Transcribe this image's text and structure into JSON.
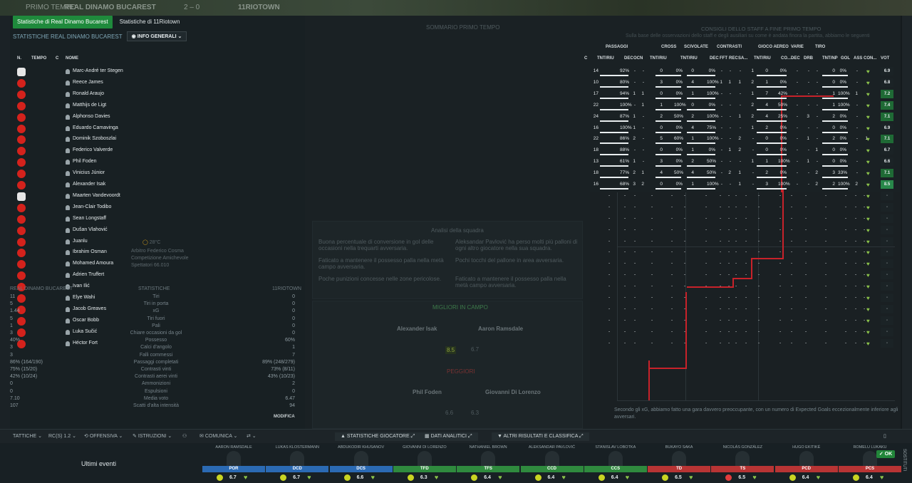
{
  "background": {
    "top_left": "PRIMO TEMPO",
    "home_team": "REAL DINAMO BUCAREST",
    "score": "2 – 0",
    "away_team": "11RIOTOWN"
  },
  "tabs": [
    {
      "label": "Statistiche di Real Dinamo Bucarest",
      "active": true
    },
    {
      "label": "Statistiche di 11Riotown",
      "active": false
    }
  ],
  "subheader": {
    "title": "STATISTICHE REAL DINAMO BUCAREST",
    "dropdown": "INFO GENERALI"
  },
  "column_groups": [
    "PASSAGGI",
    "CROSS",
    "SCIVOLATE",
    "CONTRASTI",
    "GIOCO AEREO",
    "VARIE",
    "TIRO"
  ],
  "columns": {
    "n": "N.",
    "tempo": "TEMPO",
    "c": "C",
    "nome": "NOME",
    "c2": "C",
    "pass_tnt": "TNT/RIU",
    "dec": "DEC",
    "ocn": "OCN",
    "cross_tnt": "TNT/RIU",
    "sciv_tnt": "TNT/RIU",
    "con_dec": "DEC",
    "fft": "FFT",
    "rec": "REC",
    "sa": "SA...",
    "aereo_tnt": "TNT/RIU",
    "co": "CO...",
    "varie_dec": "DEC",
    "drb": "DRB",
    "tiro": "TNT/NP",
    "gol": "GOL",
    "ass": "ASS",
    "con": "CON...",
    "vot": "VOT"
  },
  "players": [
    {
      "name": "Marc-André ter Stegen",
      "gk": true,
      "p": [
        "14",
        "92%",
        "-",
        "-"
      ],
      "cr": [
        "0",
        "0%"
      ],
      "sc": [
        "0",
        "0%"
      ],
      "ct": [
        "-",
        "-",
        "-",
        "1"
      ],
      "ae": [
        "0",
        "0%",
        "-"
      ],
      "va": [
        "-",
        "-"
      ],
      "ti": [
        "0",
        "0%"
      ],
      "g": "-",
      "a": "-",
      "v": "6.9",
      "vt": "hi"
    },
    {
      "name": "Reece James",
      "p": [
        "10",
        "80%",
        "-",
        "-"
      ],
      "cr": [
        "3",
        "0%"
      ],
      "sc": [
        "4",
        "100%"
      ],
      "ct": [
        "1",
        "1",
        "1",
        "2"
      ],
      "ae": [
        "1",
        "0%",
        "-"
      ],
      "va": [
        "-",
        "-"
      ],
      "ti": [
        "0",
        "0%"
      ],
      "g": "-",
      "a": "-",
      "v": "6.8",
      "vt": "hi"
    },
    {
      "name": "Ronald Araujo",
      "p": [
        "17",
        "94%",
        "1",
        "1"
      ],
      "cr": [
        "0",
        "0%"
      ],
      "sc": [
        "1",
        "100%"
      ],
      "ct": [
        "-",
        "-",
        "-",
        "1"
      ],
      "ae": [
        "7",
        "42%",
        "-"
      ],
      "va": [
        "-",
        "-"
      ],
      "ti": [
        "1",
        "100%"
      ],
      "g": "1",
      "a": "-",
      "v": "7.2",
      "vt": "top"
    },
    {
      "name": "Matthijs de Ligt",
      "p": [
        "22",
        "100%",
        "-",
        "1"
      ],
      "cr": [
        "1",
        "100%"
      ],
      "sc": [
        "0",
        "0%"
      ],
      "ct": [
        "-",
        "-",
        "-",
        "2"
      ],
      "ae": [
        "4",
        "50%",
        "-"
      ],
      "va": [
        "-",
        "-"
      ],
      "ti": [
        "1",
        "100%"
      ],
      "g": "-",
      "a": "-",
      "v": "7.4",
      "vt": "top"
    },
    {
      "name": "Alphonso Davies",
      "p": [
        "24",
        "87%",
        "1",
        "-"
      ],
      "cr": [
        "2",
        "50%"
      ],
      "sc": [
        "2",
        "100%"
      ],
      "ct": [
        "-",
        "-",
        "1",
        "2"
      ],
      "ae": [
        "4",
        "25%",
        "-"
      ],
      "va": [
        "3",
        "-"
      ],
      "ti": [
        "2",
        "0%"
      ],
      "g": "-",
      "a": "-",
      "v": "7.1",
      "vt": "top"
    },
    {
      "name": "Eduardo Camavinga",
      "p": [
        "16",
        "100%",
        "1",
        "-"
      ],
      "cr": [
        "0",
        "0%"
      ],
      "sc": [
        "4",
        "75%"
      ],
      "ct": [
        "-",
        "-",
        "-",
        "1"
      ],
      "ae": [
        "2",
        "0%",
        "-"
      ],
      "va": [
        "-",
        "-"
      ],
      "ti": [
        "0",
        "0%"
      ],
      "g": "-",
      "a": "-",
      "v": "6.9",
      "vt": "hi"
    },
    {
      "name": "Dominik Szoboszlai",
      "p": [
        "22",
        "86%",
        "2",
        "-"
      ],
      "cr": [
        "5",
        "60%"
      ],
      "sc": [
        "1",
        "100%"
      ],
      "ct": [
        "-",
        "-",
        "2",
        "-"
      ],
      "ae": [
        "0",
        "0%",
        "-"
      ],
      "va": [
        "1",
        "-"
      ],
      "ti": [
        "2",
        "0%"
      ],
      "g": "-",
      "a": "1",
      "v": "7.1",
      "vt": "top"
    },
    {
      "name": "Federico Valverde",
      "p": [
        "18",
        "88%",
        "-",
        "-"
      ],
      "cr": [
        "0",
        "0%"
      ],
      "sc": [
        "1",
        "0%"
      ],
      "ct": [
        "-",
        "1",
        "2",
        "-"
      ],
      "ae": [
        "0",
        "0%",
        "-"
      ],
      "va": [
        "-",
        "1"
      ],
      "ti": [
        "0",
        "0%"
      ],
      "g": "-",
      "a": "-",
      "v": "6.7",
      "vt": "hi"
    },
    {
      "name": "Phil Foden",
      "p": [
        "13",
        "61%",
        "1",
        "-"
      ],
      "cr": [
        "3",
        "0%"
      ],
      "sc": [
        "2",
        "50%"
      ],
      "ct": [
        "-",
        "-",
        "-",
        "1"
      ],
      "ae": [
        "1",
        "100%",
        "-"
      ],
      "va": [
        "1",
        "-"
      ],
      "ti": [
        "0",
        "0%"
      ],
      "g": "-",
      "a": "-",
      "v": "6.6",
      "vt": "hi"
    },
    {
      "name": "Vinicius Júnior",
      "p": [
        "18",
        "77%",
        "2",
        "1"
      ],
      "cr": [
        "4",
        "50%"
      ],
      "sc": [
        "4",
        "50%"
      ],
      "ct": [
        "-",
        "2",
        "1",
        "-"
      ],
      "ae": [
        "2",
        "0%",
        "-"
      ],
      "va": [
        "-",
        "2"
      ],
      "ti": [
        "3",
        "33%"
      ],
      "g": "-",
      "a": "-",
      "v": "7.1",
      "vt": "top"
    },
    {
      "name": "Alexander Isak",
      "p": [
        "16",
        "68%",
        "3",
        "2"
      ],
      "cr": [
        "0",
        "0%"
      ],
      "sc": [
        "1",
        "100%"
      ],
      "ct": [
        "-",
        "-",
        "1",
        "-"
      ],
      "ae": [
        "3",
        "100%",
        "-"
      ],
      "va": [
        "-",
        "2"
      ],
      "ti": [
        "2",
        "100%"
      ],
      "g": "2",
      "a": "-",
      "v": "8.5",
      "vt": "best"
    },
    {
      "name": "Maarten Vandevoordt",
      "gk": true,
      "sub": true
    },
    {
      "name": "Jean-Clair Todibo",
      "sub": true
    },
    {
      "name": "Sean Longstaff",
      "sub": true
    },
    {
      "name": "Dušan Vlahović",
      "sub": true
    },
    {
      "name": "Juanlu",
      "sub": true
    },
    {
      "name": "Ibrahim Osman",
      "sub": true
    },
    {
      "name": "Mohamed Amoura",
      "sub": true
    },
    {
      "name": "Adrien Truffert",
      "sub": true
    },
    {
      "name": "Ivan Ilić",
      "sub": true
    },
    {
      "name": "Elye Wahi",
      "sub": true
    },
    {
      "name": "Jacob Greaves",
      "sub": true
    },
    {
      "name": "Oscar Bobb",
      "sub": true
    },
    {
      "name": "Luka Sučić",
      "sub": true
    },
    {
      "name": "Héctor Fort",
      "sub": true
    }
  ],
  "center": {
    "summary_title": "SOMMARIO PRIMO TEMPO",
    "staff_title": "CONSIGLI DELLO STAFF A FINE PRIMO TEMPO",
    "staff_sub": "Sulla base delle osservazioni dello staff e degli ausiliari su come è andata finora la partita, abbiamo le seguenti",
    "analysis_title": "Analisi della squadra",
    "analysis_left": [
      "Buona percentuale di conversione in gol delle occasioni nella trequarti avversaria.",
      "Faticato a mantenere il possesso palla nella metà campo avversaria.",
      "Poche punizioni concesse nelle zone pericolose."
    ],
    "analysis_right": [
      "Aleksandar Pavlović ha perso molti più palloni di ogni altro giocatore nella sua squadra.",
      "Pochi tocchi del pallone in area avversaria.",
      "Faticato a mantenere il possesso palla nella metà campo avversaria."
    ],
    "best_title": "MIGLIORI IN CAMPO",
    "best_home": "Alexander Isak",
    "best_away": "Aaron Ramsdale",
    "worst_title": "PEGGIORI",
    "worst_home": "Phil Foden",
    "worst_away": "Giovanni Di Lorenzo",
    "best_home_rating": "8.5",
    "best_away_rating": "6.7",
    "worst_home_rating": "6.6",
    "worst_away_rating": "6.3"
  },
  "staff_note": "Secondo gli xG, abbiamo fatto una gara davvero preoccupante, con un numero di Expected Goals eccezionalmente inferiore agli avversari.",
  "left_stats": {
    "header_home": "REAL DINAMO BUCAREST",
    "header_mid": "STATISTICHE",
    "header_away": "11RIOTOWN",
    "rows": [
      {
        "h": "11",
        "l": "Tiri",
        "a": "0"
      },
      {
        "h": "5",
        "l": "Tiri in porta",
        "a": "0"
      },
      {
        "h": "1.44",
        "l": "xG",
        "a": "0"
      },
      {
        "h": "5",
        "l": "Tiri fuori",
        "a": "0"
      },
      {
        "h": "1",
        "l": "Pali",
        "a": "0"
      },
      {
        "h": "3",
        "l": "Chiare occasioni da gol",
        "a": "0"
      },
      {
        "h": "40%",
        "l": "Possesso",
        "a": "60%"
      },
      {
        "h": "3",
        "l": "Calci d'angolo",
        "a": "1"
      },
      {
        "h": "3",
        "l": "Falli commessi",
        "a": "7"
      },
      {
        "h": "86% (164/190)",
        "l": "Passaggi completati",
        "a": "89% (248/279)"
      },
      {
        "h": "75% (15/20)",
        "l": "Contrasti vinti",
        "a": "73% (8/11)"
      },
      {
        "h": "42% (10/24)",
        "l": "Contrasti aerei vinti",
        "a": "43% (10/23)"
      },
      {
        "h": "0",
        "l": "Ammonizioni",
        "a": "2"
      },
      {
        "h": "0",
        "l": "Espulsioni",
        "a": "0"
      },
      {
        "h": "7.10",
        "l": "Media voto",
        "a": "6.47"
      },
      {
        "h": "107",
        "l": "Scatti d'alta intensità",
        "a": "94"
      }
    ],
    "modifica": "MODIFICA",
    "arbitro": "Arbitro Federico Cosma",
    "competizione": "Competizione Amichevole",
    "spettatori": "Spettatori 66.010",
    "temp": "28°C"
  },
  "toolbar": {
    "tattiche": "TATTICHE",
    "modulo": "RC(S) 1.2",
    "offensiva": "OFFENSIVA",
    "istruzioni": "ISTRUZIONI",
    "comunica": "COMUNICA",
    "stat_giocatore": "STATISTICHE GIOCATORE",
    "dati_analitici": "DATI ANALITICI",
    "altri_risultati": "ALTRI RISULTATI E CLASSIFICA"
  },
  "bottom": {
    "ultimi": "Ultimi eventi",
    "ok": "OK",
    "sostituti": "SOSTITUTI",
    "players": [
      {
        "name": "AARON RAMSDALE",
        "pos": "POR",
        "val": "6.7",
        "color": "#2b6ab3",
        "face": "yellow"
      },
      {
        "name": "LUKAS KLOSTERMANN",
        "pos": "DCD",
        "val": "6.7",
        "color": "#2b6ab3",
        "face": "yellow"
      },
      {
        "name": "ABDUKODIR KHUSANOV",
        "pos": "DCS",
        "val": "6.6",
        "color": "#2b6ab3",
        "face": "yellow"
      },
      {
        "name": "GIOVANNI DI LORENZO",
        "pos": "TFD",
        "val": "6.3",
        "color": "#2f8a3e",
        "face": "yellow"
      },
      {
        "name": "NATHANIEL BROWN",
        "pos": "TFS",
        "val": "6.4",
        "color": "#2f8a3e",
        "face": "yellow"
      },
      {
        "name": "ALEKSANDAR PAVLOVIĆ",
        "pos": "CCD",
        "val": "6.4",
        "color": "#2f8a3e",
        "face": "yellow"
      },
      {
        "name": "STANISLAV LOBOTKA",
        "pos": "CCS",
        "val": "6.4",
        "color": "#2f8a3e",
        "face": "yellow"
      },
      {
        "name": "BUKAYO SAKA",
        "pos": "TD",
        "val": "6.5",
        "color": "#b83434",
        "face": "yellow"
      },
      {
        "name": "NICOLÁS GONZÁLEZ",
        "pos": "TS",
        "val": "6.5",
        "color": "#b83434",
        "face": "red"
      },
      {
        "name": "HUGO EKITIKÉ",
        "pos": "PCD",
        "val": "6.4",
        "color": "#b83434",
        "face": "yellow"
      },
      {
        "name": "ROMELU LUKAKU",
        "pos": "PCS",
        "val": "6.4",
        "color": "#b83434",
        "face": "yellow"
      }
    ]
  }
}
